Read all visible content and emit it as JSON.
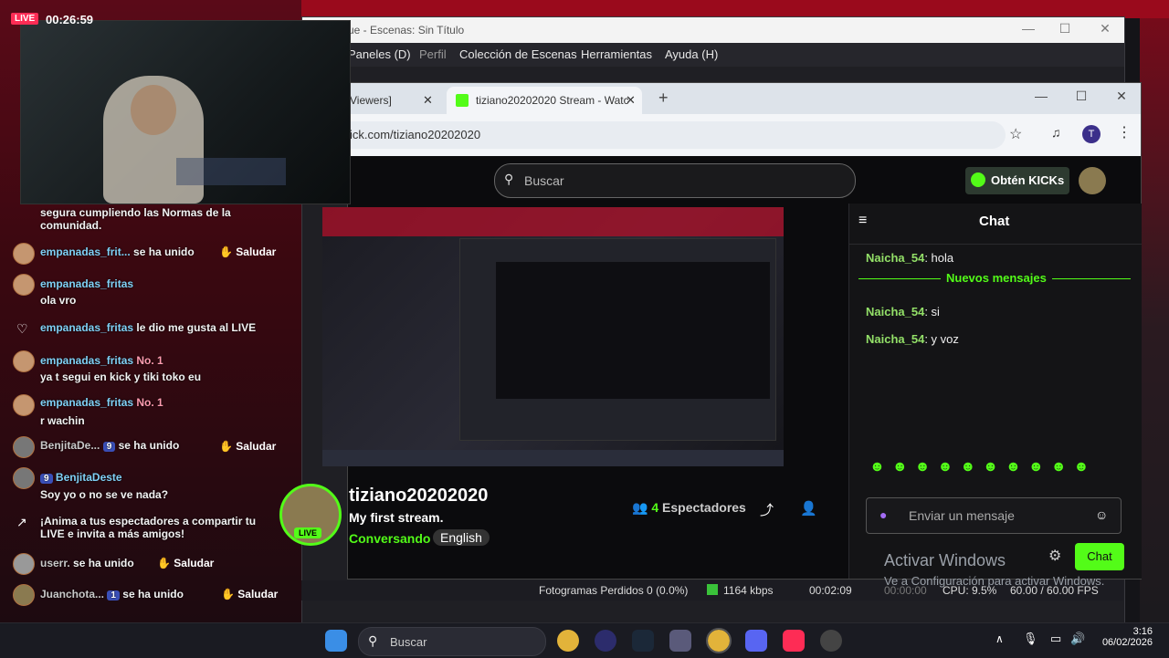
{
  "overlay": {
    "live_badge": "LIVE",
    "clock": "00:26:59",
    "top_msg": "segura cumpliendo las Normas de la comunidad.",
    "msgs": [
      {
        "name": "empanadas_frit...",
        "text": "se ha unido",
        "action": "Saludar"
      },
      {
        "name": "empanadas_fritas",
        "text": "ola vro"
      },
      {
        "name": "empanadas_fritas",
        "text": "le dio me gusta al LIVE"
      },
      {
        "name": "empanadas_fritas",
        "badge": "No. 1",
        "text": "ya t segui en kick y tiki toko eu"
      },
      {
        "name": "empanadas_fritas",
        "badge": "No. 1",
        "text": "r wachin"
      },
      {
        "name": "BenjitaDe...",
        "badge": "9",
        "text": "se ha unido",
        "action": "Saludar"
      },
      {
        "name": "BenjitaDeste",
        "badge": "9",
        "text": "Soy yo o no se ve nada?"
      },
      {
        "text": "¡Anima a tus espectadores a compartir tu LIVE e invita a más amigos!"
      },
      {
        "name": "userr.",
        "text": "se ha unido",
        "action": "Saludar"
      },
      {
        "name": "Juanchota...",
        "badge": "1",
        "text": "se ha unido",
        "action": "Saludar"
      }
    ]
  },
  "obs": {
    "title": "ue - Escenas: Sin Título",
    "menu": [
      "Paneles (D)",
      "Perfil",
      "Colección de Escenas",
      "Herramientas",
      "Ayuda (H)"
    ],
    "status": {
      "dropped": "Fotogramas Perdidos 0 (0.0%)",
      "kbps": "1164 kbps",
      "time1": "00:02:09",
      "time2": "00:00:00",
      "cpu": "CPU: 9.5%",
      "fps": "60.00 / 60.00 FPS"
    }
  },
  "chrome": {
    "tab1": "Viewers]",
    "tab2": "tiziano20202020 Stream - Watc",
    "url": "ick.com/tiziano20202020",
    "profile": "T"
  },
  "kick": {
    "search_placeholder": "Buscar",
    "kicks_btn": "Obtén KICKs",
    "chat_title": "Chat",
    "chat": [
      {
        "user": "Naicha_54",
        "text": ": hola"
      },
      {
        "divider": "Nuevos mensajes"
      },
      {
        "user": "Naicha_54",
        "text": ": si"
      },
      {
        "user": "Naicha_54",
        "text": ": y voz"
      }
    ],
    "chat_placeholder": "Enviar un mensaje",
    "chat_send": "Chat",
    "channel": "tiziano20202020",
    "stream_title": "My first stream.",
    "category": "Conversando",
    "language": "English",
    "viewers_count": "4",
    "viewers_label": "Espectadores",
    "live": "LIVE"
  },
  "windows": {
    "activate_title": "Activar Windows",
    "activate_sub": "Ve a Configuración para activar Windows.",
    "search_placeholder": "Buscar",
    "time": "3:16",
    "date": "06/02/2026"
  }
}
